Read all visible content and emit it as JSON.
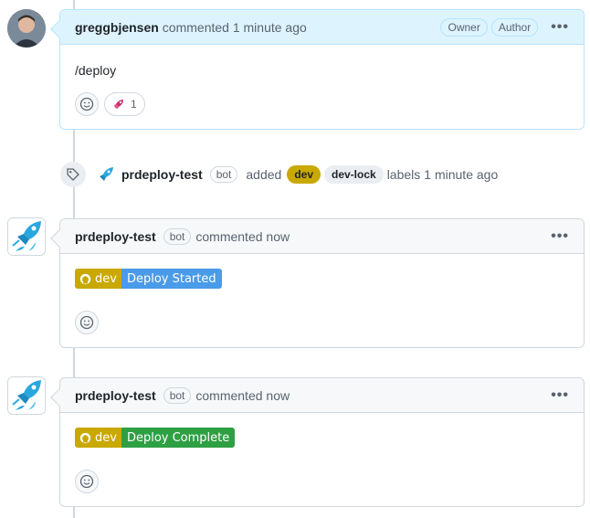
{
  "comments": [
    {
      "author": "greggbjensen",
      "meta": "commented 1 minute ago",
      "badges": [
        "Owner",
        "Author"
      ],
      "body": "/deploy",
      "reaction": {
        "emoji": "rocket",
        "count": "1"
      }
    },
    {
      "author": "prdeploy-test",
      "bot_badge": "bot",
      "meta": "commented now",
      "shield": {
        "left": "dev",
        "right": "Deploy Started",
        "right_color": "#4a9be8"
      }
    },
    {
      "author": "prdeploy-test",
      "bot_badge": "bot",
      "meta": "commented now",
      "shield": {
        "left": "dev",
        "right": "Deploy Complete",
        "right_color": "#2ea043"
      }
    }
  ],
  "event": {
    "actor": "prdeploy-test",
    "bot_badge": "bot",
    "action": "added",
    "labels": [
      {
        "name": "dev",
        "bg": "#c9a800",
        "fg": "#1f2328"
      },
      {
        "name": "dev-lock",
        "bg": "#eaeef2",
        "fg": "#1f2328"
      }
    ],
    "suffix": "labels",
    "time": "1 minute ago"
  },
  "menu_glyph": "•••",
  "colors": {
    "border": "#d0d7de",
    "owner_header": "#ddf4ff",
    "shield_left": "#c9a800"
  }
}
